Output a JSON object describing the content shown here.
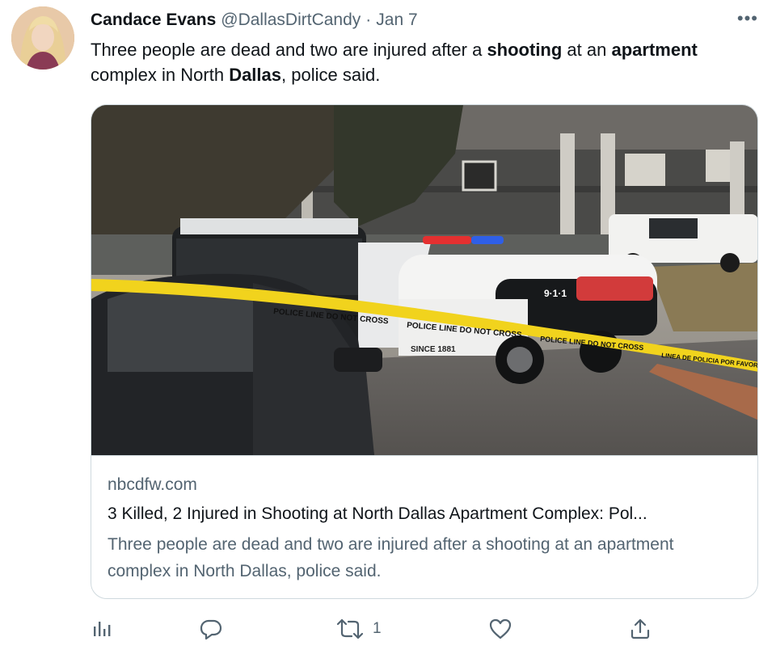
{
  "author": {
    "name": "Candace Evans",
    "handle": "@DallasDirtCandy",
    "separator": "·",
    "date": "Jan 7"
  },
  "more_label": "•••",
  "tweet": {
    "segments": [
      {
        "text": "Three people are dead and two are injured after a ",
        "bold": false
      },
      {
        "text": "shooting",
        "bold": true
      },
      {
        "text": " at an ",
        "bold": false
      },
      {
        "text": "apartment",
        "bold": true
      },
      {
        "text": " complex in North ",
        "bold": false
      },
      {
        "text": "Dallas",
        "bold": true
      },
      {
        "text": ", police said.",
        "bold": false
      }
    ]
  },
  "card": {
    "domain": "nbcdfw.com",
    "title": "3 Killed, 2 Injured in Shooting at North Dallas Apartment Complex: Pol...",
    "description": "Three people are dead and two are injured after a shooting at an apartment complex in North Dallas, police said.",
    "image": {
      "tape_text_1": "POLICE LINE DO NOT CROSS",
      "tape_text_2": "POLICE LINE DO NOT CROSS",
      "tape_text_3": "POLICE LINE DO NOT CROSS",
      "tape_text_4": "LINEA DE POLICIA POR FAVOR NO C",
      "car_number": "9·1·1",
      "car_text": "SINCE 1881"
    }
  },
  "actions": {
    "analytics_icon": "analytics-icon",
    "reply_icon": "reply-icon",
    "retweet_icon": "retweet-icon",
    "retweet_count": "1",
    "like_icon": "like-icon",
    "share_icon": "share-icon"
  }
}
